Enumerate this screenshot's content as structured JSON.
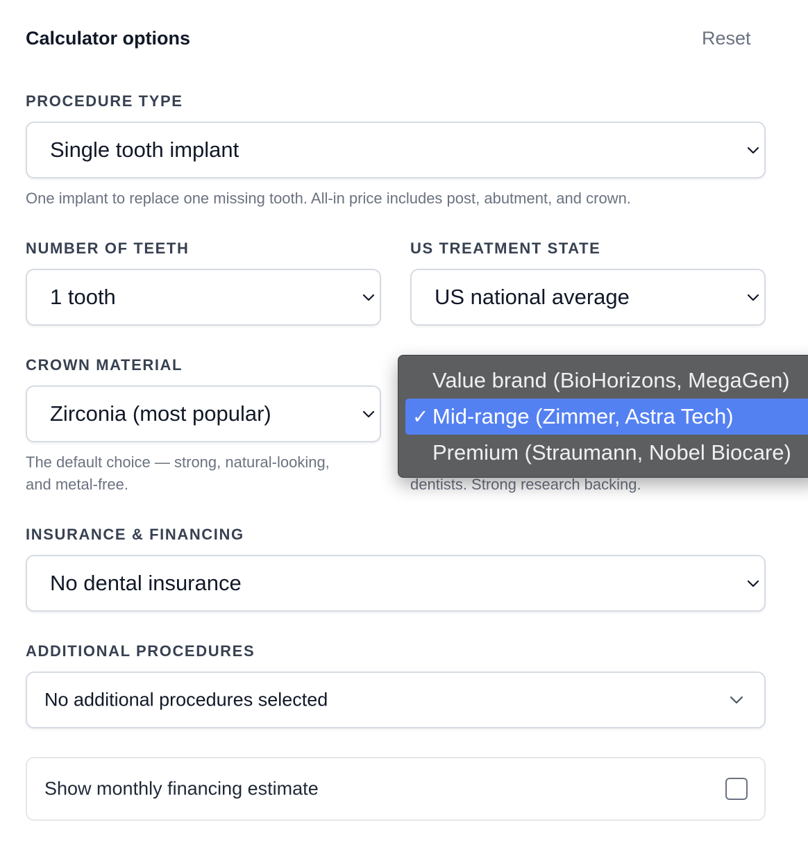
{
  "header": {
    "title": "Calculator options",
    "reset_label": "Reset"
  },
  "procedure": {
    "label": "PROCEDURE TYPE",
    "value": "Single tooth implant",
    "help": "One implant to replace one missing tooth. All-in price includes post, abutment, and crown."
  },
  "teeth": {
    "label": "NUMBER OF TEETH",
    "value": "1 tooth"
  },
  "state": {
    "label": "US TREATMENT STATE",
    "value": "US national average"
  },
  "crown": {
    "label": "CROWN MATERIAL",
    "value": "Zirconia (most popular)",
    "help_line1": "The default choice — strong, natural-looking,",
    "help_line2": "and metal-free."
  },
  "brand": {
    "help_visible": "dentists. Strong research backing.",
    "options": [
      {
        "label": "Value brand (BioHorizons, MegaGen)",
        "selected": false
      },
      {
        "label": "Mid-range (Zimmer, Astra Tech)",
        "selected": true
      },
      {
        "label": "Premium (Straumann, Nobel Biocare)",
        "selected": false
      }
    ],
    "check_glyph": "✓"
  },
  "insurance": {
    "label": "INSURANCE & FINANCING",
    "value": "No dental insurance"
  },
  "additional": {
    "label": "ADDITIONAL PROCEDURES",
    "value": "No additional procedures selected"
  },
  "financing_toggle": {
    "label": "Show monthly financing estimate",
    "checked": false
  },
  "colors": {
    "accent": "#5481f2",
    "popup_bg": "#5c5e5f",
    "border": "#d6dbe3"
  },
  "icons": {
    "select_arrow": "chevron-down-icon"
  }
}
